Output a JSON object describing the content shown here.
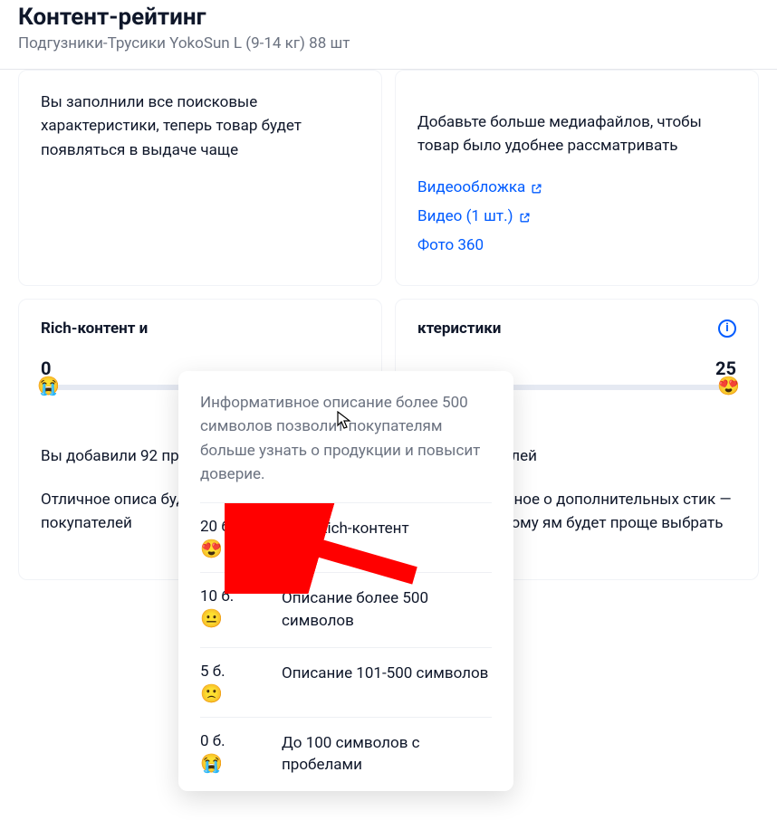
{
  "header": {
    "title": "Контент-рейтинг",
    "subtitle": "Подгузники-Трусики YokoSun L (9-14 кг) 88 шт"
  },
  "cards": {
    "left": {
      "text": "Вы заполнили все поисковые характеристики, теперь товар будет появляться в выдаче чаще"
    },
    "right": {
      "text": "Добавьте больше медиафайлов, чтобы товар было удобнее рассматривать",
      "links": {
        "videocover": "Видеообложка",
        "video": "Видео (1 шт.)",
        "photo360": "Фото 360"
      }
    }
  },
  "score": {
    "left": {
      "title": "Rich-контент и",
      "value": "0",
      "emoji": "😭",
      "desc1": "Вы добавили 92 пробелами",
      "desc2": "Отличное описа будет вызывать покупателей"
    },
    "right": {
      "title": "ктеристики",
      "value": "25",
      "emoji": "😍",
      "desc1": "или 0 из 0 полей",
      "desc2": "или достаточное о дополнительных стик — благодаря этому ям будет проще выбрать среди других"
    }
  },
  "tooltip": {
    "head": "Информативное описание более 500 символов позволит покупателям больше узнать о продукции и повысит доверие.",
    "rows": [
      {
        "points": "20 б.",
        "emoji": "😍",
        "label": "Есть Rich-контент"
      },
      {
        "points": "10 б.",
        "emoji": "😐",
        "label": "Описание более 500 символов"
      },
      {
        "points": "5 б.",
        "emoji": "🙁",
        "label": "Описание 101-500 символов"
      },
      {
        "points": "0 б.",
        "emoji": "😭",
        "label": "До 100 символов с пробелами"
      }
    ]
  }
}
